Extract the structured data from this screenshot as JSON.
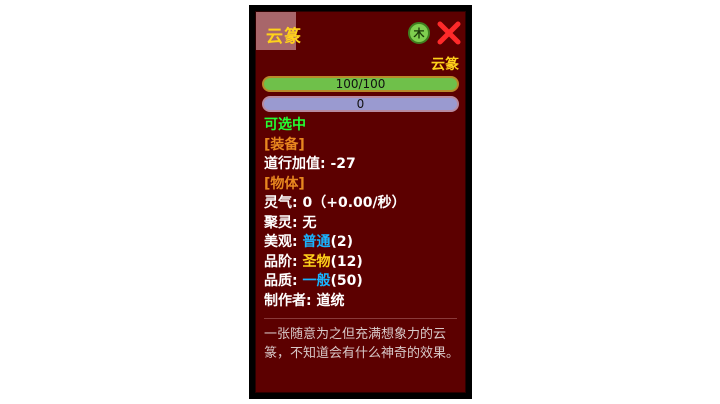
{
  "item": {
    "name": "云篆",
    "element": "木",
    "type_label": "云篆",
    "hp_text": "100/100",
    "hp_fill": 1.0,
    "mp_text": "0",
    "mp_fill": 0.0
  },
  "status": {
    "selectable": "可选中"
  },
  "sections": {
    "equip": "[装备]",
    "object": "[物体]"
  },
  "stats": {
    "dao_bonus_label": "道行加值:",
    "dao_bonus_value": "-27",
    "lingqi_label": "灵气:",
    "lingqi_value": "0（+0.00/秒）",
    "jilin_label": "聚灵:",
    "jilin_value": "无",
    "beauty_label": "美观:",
    "beauty_grade": "普通",
    "beauty_num": "(2)",
    "rank_label": "品阶:",
    "rank_grade": "圣物",
    "rank_num": "(12)",
    "quality_label": "品质:",
    "quality_grade": "一般",
    "quality_num": "(50)",
    "maker_label": "制作者:",
    "maker_value": "道统"
  },
  "description": "一张随意为之但充满想象力的云篆，不知道会有什么神奇的效果。",
  "colors": {
    "panel_bg": "#5c0000",
    "title": "#ffd21a",
    "green": "#22ff33",
    "section": "#e8871f",
    "blue_grade": "#19b4ff",
    "close": "#ff2a2a"
  },
  "icons": {
    "close": "close-icon",
    "element": "wood-element-icon"
  }
}
